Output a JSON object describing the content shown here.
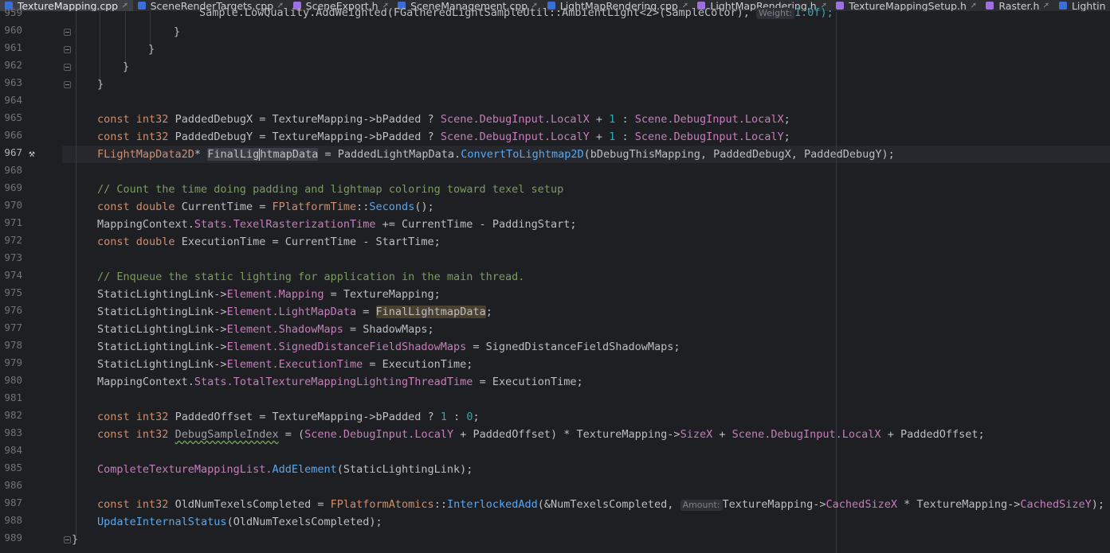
{
  "tabs": [
    {
      "label": "TextureMapping.cpp",
      "kind": "cpp",
      "active": true
    },
    {
      "label": "SceneRenderTargets.cpp",
      "kind": "cpp",
      "active": false
    },
    {
      "label": "SceneExport.h",
      "kind": "h",
      "active": false
    },
    {
      "label": "SceneManagement.cpp",
      "kind": "cpp",
      "active": false
    },
    {
      "label": "LightMapRendering.cpp",
      "kind": "cpp",
      "active": false
    },
    {
      "label": "LightMapRendering.h",
      "kind": "h",
      "active": false
    },
    {
      "label": "TextureMappingSetup.h",
      "kind": "h",
      "active": false
    },
    {
      "label": "Raster.h",
      "kind": "h",
      "active": false
    },
    {
      "label": "Lightin",
      "kind": "cpp",
      "active": false
    }
  ],
  "line_numbers": [
    "959",
    "960",
    "961",
    "962",
    "963",
    "964",
    "965",
    "966",
    "967",
    "968",
    "969",
    "970",
    "971",
    "972",
    "973",
    "974",
    "975",
    "976",
    "977",
    "978",
    "979",
    "980",
    "981",
    "982",
    "983",
    "984",
    "985",
    "986",
    "987",
    "988",
    "989"
  ],
  "current_line": "967",
  "hints": {
    "weight": "Weight:",
    "amount": "Amount:"
  },
  "code": {
    "l959": {
      "a": "Sample.LowQuality.AddWeighted(FGatheredLightSampleUtil::AmbientLight<2>(SampleColor), ",
      "b": "1.0f);"
    },
    "l960": "}",
    "l961": "}",
    "l962": "}",
    "l963": "}",
    "l965": {
      "k1": "const ",
      "t1": "int32 ",
      "v1": "PaddedDebugX = TextureMapping->bPadded ? ",
      "m1": "Scene.",
      "m2": "DebugInput.",
      "m3": "LocalX",
      "o1": " + ",
      "n1": "1",
      "o2": " : ",
      "m4": "Scene.",
      "m5": "DebugInput.",
      "m6": "LocalX",
      "e": ";"
    },
    "l966": {
      "k1": "const ",
      "t1": "int32 ",
      "v1": "PaddedDebugY = TextureMapping->bPadded ? ",
      "m1": "Scene.",
      "m2": "DebugInput.",
      "m3": "LocalY",
      "o1": " + ",
      "n1": "1",
      "o2": " : ",
      "m4": "Scene.",
      "m5": "DebugInput.",
      "m6": "LocalY",
      "e": ";"
    },
    "l967": {
      "t1": "FLightMapData2D",
      "s1": "* ",
      "w1": "FinalLig",
      "w2": "htmapData",
      "v1": " = PaddedLightMapData.",
      "f1": "ConvertToLightmap2D",
      "v2": "(bDebugThisMapping, PaddedDebugX, PaddedDebugY);"
    },
    "l969": "// Count the time doing padding and lightmap coloring toward texel setup",
    "l970": {
      "k1": "const ",
      "k2": "double ",
      "v1": "CurrentTime = ",
      "t1": "FPlatformTime",
      "v2": "::",
      "f1": "Seconds",
      "v3": "();"
    },
    "l971": {
      "v1": "MappingContext.",
      "m1": "Stats.",
      "m2": "TexelRasterizationTime",
      "v2": " += CurrentTime - PaddingStart;"
    },
    "l972": {
      "k1": "const ",
      "k2": "double ",
      "v1": "ExecutionTime = CurrentTime - StartTime;"
    },
    "l974": "// Enqueue the static lighting for application in the main thread.",
    "l975": {
      "v1": "StaticLightingLink->",
      "m1": "Element.",
      "m2": "Mapping",
      "v2": " = TextureMapping;"
    },
    "l976": {
      "v1": "StaticLightingLink->",
      "m1": "Element.",
      "m2": "LightMapData",
      "v2": " = ",
      "w1": "FinalLightmapData",
      "v3": ";"
    },
    "l977": {
      "v1": "StaticLightingLink->",
      "m1": "Element.",
      "m2": "ShadowMaps",
      "v2": " = ShadowMaps;"
    },
    "l978": {
      "v1": "StaticLightingLink->",
      "m1": "Element.",
      "m2": "SignedDistanceFieldShadowMaps",
      "v2": " = SignedDistanceFieldShadowMaps;"
    },
    "l979": {
      "v1": "StaticLightingLink->",
      "m1": "Element.",
      "m2": "ExecutionTime",
      "v2": " = ExecutionTime;"
    },
    "l980": {
      "v1": "MappingContext.",
      "m1": "Stats.",
      "m2": "TotalTextureMappingLightingThreadTime",
      "v2": " = ExecutionTime;"
    },
    "l982": {
      "k1": "const ",
      "t1": "int32 ",
      "v1": "PaddedOffset = TextureMapping->bPadded ? ",
      "n1": "1",
      "o1": " : ",
      "n2": "0",
      "e": ";"
    },
    "l983": {
      "k1": "const ",
      "t1": "int32 ",
      "s1": "DebugSampleIndex",
      "v1": " = (",
      "m1": "Scene.",
      "m2": "DebugInput.",
      "m3": "LocalY",
      "v2": " + PaddedOffset) * TextureMapping->",
      "m4": "SizeX",
      "v3": " + ",
      "m5": "Scene.",
      "m6": "DebugInput.",
      "m7": "LocalX",
      "v4": " + PaddedOffset;"
    },
    "l985": {
      "v1": "CompleteTextureMappingList.",
      "f1": "AddElement",
      "v2": "(StaticLightingLink);"
    },
    "l987": {
      "k1": "const ",
      "t1": "int32 ",
      "v1": "OldNumTexelsCompleted = ",
      "t2": "FPlatformAtomics",
      "v2": "::",
      "f1": "InterlockedAdd",
      "v3": "(&NumTexelsCompleted, ",
      "v4": "TextureMapping->",
      "m1": "CachedSizeX",
      "v5": " * TextureMapping->",
      "m2": "CachedSizeY",
      "v6": ");"
    },
    "l988": {
      "f1": "UpdateInternalStatus",
      "v1": "(OldNumTexelsCompleted);"
    },
    "l989": "}"
  }
}
